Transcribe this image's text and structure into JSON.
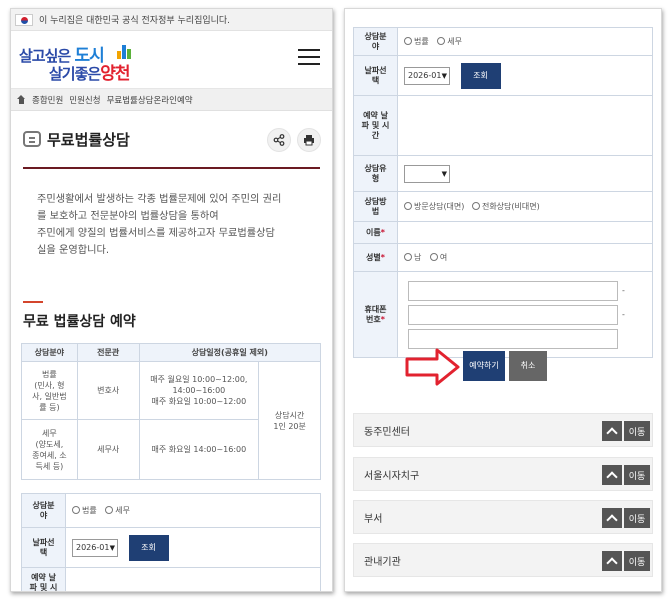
{
  "gov_banner": {
    "text": "이 누리집은 대한민국 공식 전자정부 누리집입니다."
  },
  "logo": {
    "line1_a": "살고싶은",
    "line1_b": "도시",
    "line2_a": "살기좋은",
    "line2_b": "양천"
  },
  "breadcrumb": [
    "종합민원",
    "민원신청",
    "무료법률상담온라인예약"
  ],
  "page_title": "무료법률상담",
  "intro": {
    "line1": "주민생활에서 발생하는 각종 법률문제에 있어 주민의 권리",
    "line2": "를 보호하고 전문분야의 법률상담을 통하여",
    "line3": "주민에게 양질의 법률서비스를 제공하고자 무료법률상담",
    "line4": "실을 운영합니다."
  },
  "section_title": "무료 법률상담 예약",
  "schedule_table": {
    "headers": [
      "상담분야",
      "전문관",
      "상담일정(공휴일 제외)"
    ],
    "rows": [
      {
        "field_l1": "법률",
        "field_l2": "(민사, 형",
        "field_l3": "사, 일반법",
        "field_l4": "률 등)",
        "expert": "변호사",
        "sched_l1": "매주 월요일 10:00~12:00,",
        "sched_l2": "14:00~16:00",
        "sched_l3": "매주 화요일 10:00~12:00"
      },
      {
        "field_l1": "세무",
        "field_l2": "(양도세,",
        "field_l3": "종여세, 소",
        "field_l4": "득세 등)",
        "expert": "세무사",
        "sched_l1": "매주 화요일 14:00~16:00"
      }
    ],
    "duration_l1": "상담시간",
    "duration_l2": "1인 20분"
  },
  "form": {
    "field_label_l1": "상담분",
    "field_label_l2": "야",
    "opt_law": "법률",
    "opt_tax": "세무",
    "date_label_l1": "날파선",
    "date_label_l2": "택",
    "date_value": "2026-01",
    "lookup_button": "조회",
    "reserve_label_l1": "예약 날",
    "reserve_label_l2": "파 및 시",
    "reserve_label_l3": "간",
    "type_label_l1": "상담유",
    "type_label_l2": "형",
    "method_label_l1": "상담방",
    "method_label_l2": "법",
    "method_visit": "방문상담(대면)",
    "method_phone": "전화상담(비대면)",
    "name_label": "이름",
    "gender_label": "성별",
    "gender_m": "남",
    "gender_f": "여",
    "phone_label_l1": "휴대폰",
    "phone_label_l2": "번호",
    "required_mark": "*",
    "dash": "-"
  },
  "actions": {
    "reserve": "예약하기",
    "cancel": "취소"
  },
  "accordions": [
    {
      "label": "동주민센터",
      "go": "이동"
    },
    {
      "label": "서울시자치구",
      "go": "이동"
    },
    {
      "label": "부서",
      "go": "이동"
    },
    {
      "label": "관내기관",
      "go": "이동"
    }
  ],
  "colors": {
    "navy": "#1f3f74",
    "accent_red": "#e2222f",
    "logo_blue": "#2b4aa8"
  }
}
